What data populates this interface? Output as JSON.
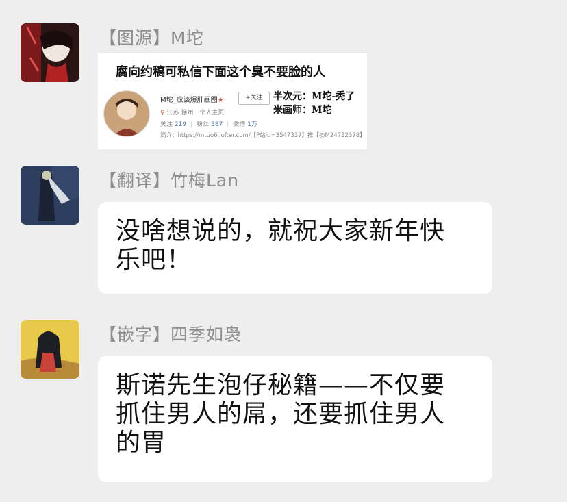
{
  "messages": [
    {
      "sender": "【图源】M坨",
      "card": {
        "title": "腐向约稿可私信下面这个臭不要脸的人",
        "username": "M坨_应该爆肝画图",
        "verified_mark": "★",
        "follow_label": "+关注",
        "location": "江苏 徐州",
        "homepage": "个人主页",
        "stats": [
          {
            "label": "关注",
            "value": "219"
          },
          {
            "label": "粉丝",
            "value": "387"
          },
          {
            "label": "微博",
            "value": "1万"
          }
        ],
        "bio": "简介：https://mtuo6.lofter.com/【P站id=3547337】推【@M24732378】",
        "right_lines": [
          "半次元：M坨-秃了",
          "米画师：M坨"
        ]
      }
    },
    {
      "sender": "【翻译】竹梅Lan",
      "text_lines": [
        "没啥想说的，就祝大家新年快",
        "乐吧！"
      ]
    },
    {
      "sender": "【嵌字】四季如袅",
      "text_lines": [
        "斯诺先生泡仔秘籍——不仅要",
        "抓住男人的屌，还要抓住男人",
        "的胃"
      ]
    }
  ],
  "colors": {
    "background": "#eeeeee",
    "bubble": "#ffffff",
    "sender_text": "#8e8e8e",
    "message_text": "#111111",
    "stat_number": "#4b7bb4"
  }
}
